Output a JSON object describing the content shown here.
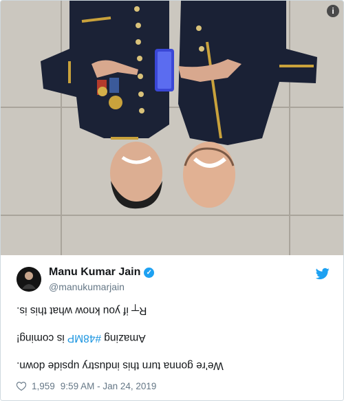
{
  "tweet": {
    "author_name": "Manu Kumar Jain",
    "author_handle": "@manukumarjain",
    "line1": "R┬ if you know what this is.",
    "line2_before": "Amazing ",
    "line2_hashtag": "#48MP",
    "line2_after": " is coming!",
    "line3": "We're gonna turn this industry upside down.",
    "likes": "1,959",
    "timestamp": "9:59 AM - Jan 24, 2019"
  },
  "icons": {
    "info": "info-icon",
    "verified": "verified-badge-icon",
    "twitter": "twitter-bird-icon",
    "like": "heart-icon"
  },
  "colors": {
    "accent": "#1da1f2",
    "link": "#1b95e0",
    "text": "#14171a",
    "muted": "#657786"
  }
}
